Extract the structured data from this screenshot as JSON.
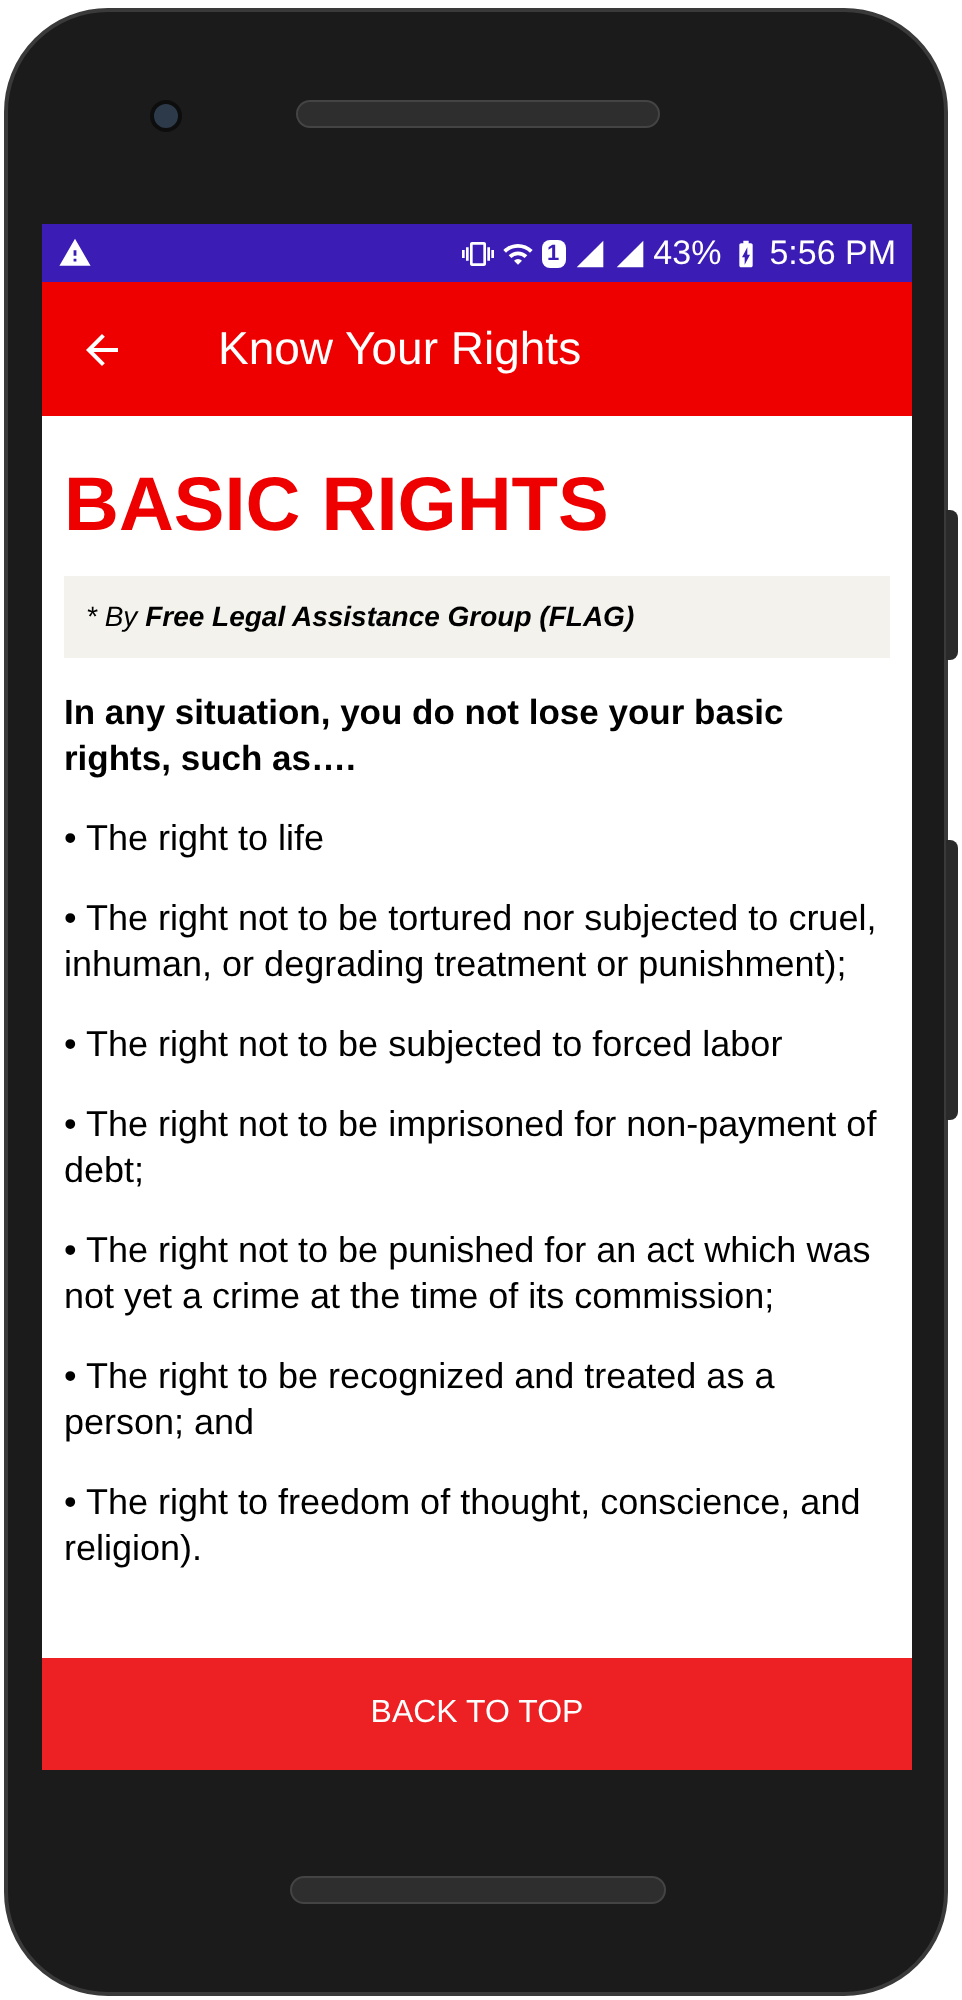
{
  "status_bar": {
    "sim": "1",
    "battery": "43%",
    "time": "5:56 PM"
  },
  "toolbar": {
    "title": "Know Your Rights"
  },
  "article": {
    "heading": "BASIC RIGHTS",
    "byline": "* By **Free Legal Assistance Group (FLAG)**",
    "intro": "In any situation, you do not lose your basic rights, such as….",
    "items": [
      "• The right to life",
      "• The right not to be tortured nor subjected to cruel, inhuman, or degrading treatment or punishment);",
      "• The right not to be subjected to forced labor",
      "• The right not to be imprisoned for non-payment of debt;",
      "• The right not to be punished for an act which was not yet a crime at the time of its commission;",
      "• The right to be recognized and treated as a person; and",
      "• The right to freedom of thought, conscience, and religion)."
    ]
  },
  "back_to_top": "BACK TO TOP"
}
